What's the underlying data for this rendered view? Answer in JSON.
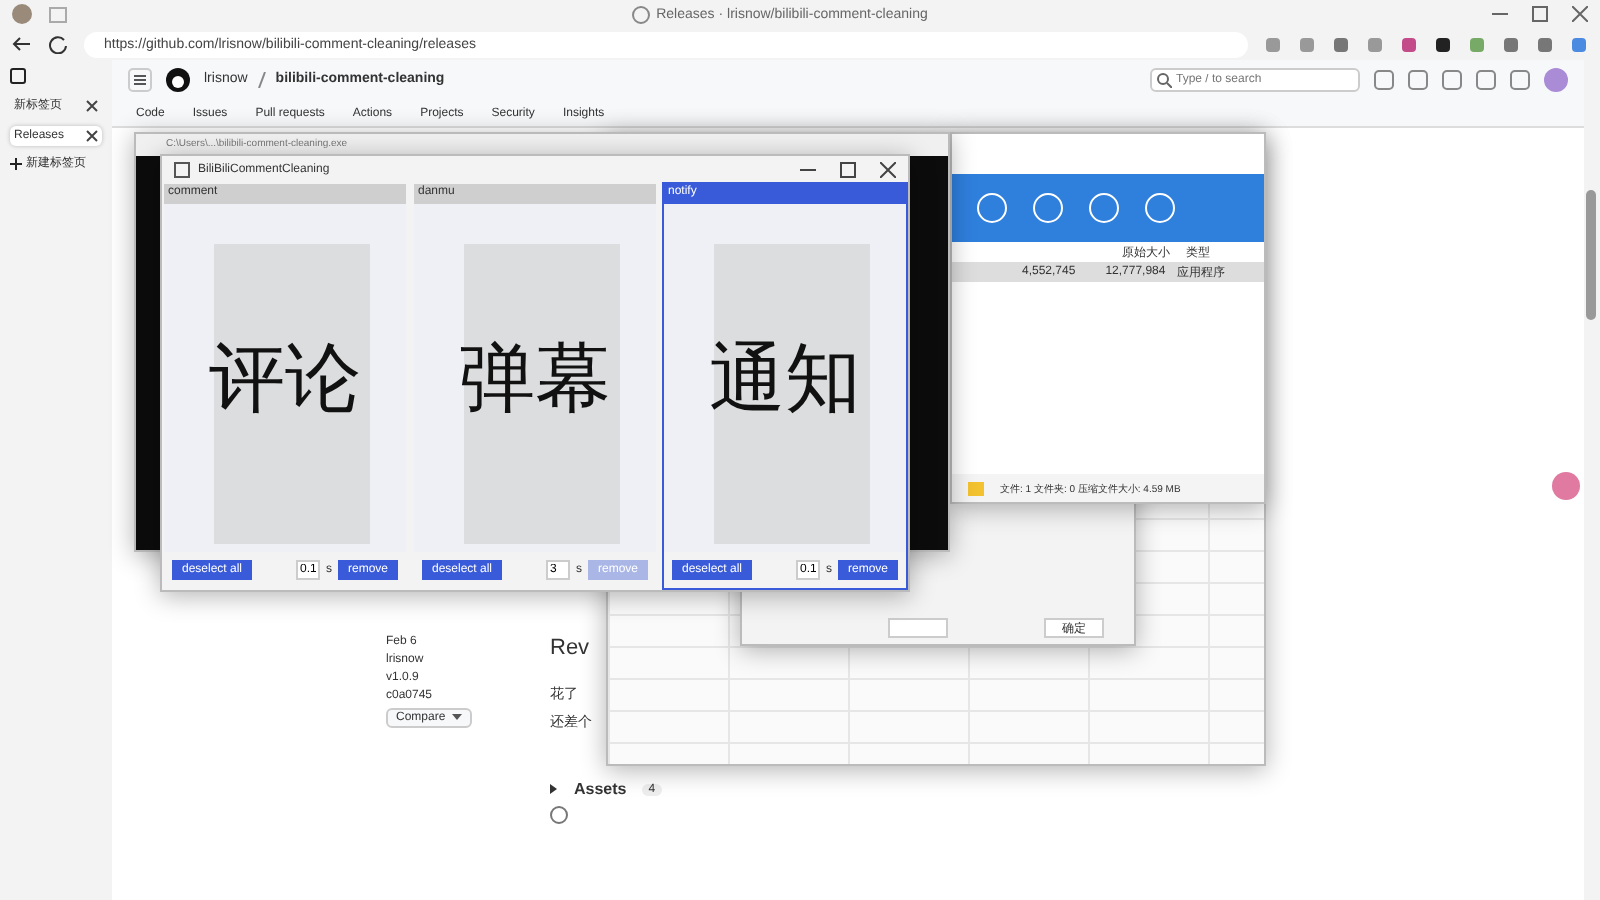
{
  "browser": {
    "tab_title": "Releases · lrisnow/bilibili-comment-cleaning",
    "url": "https://github.com/lrisnow/bilibili-comment-cleaning/releases",
    "vertical_tabs": [
      {
        "label": "新标签页",
        "selected": false
      },
      {
        "label": "Releases",
        "selected": true
      }
    ],
    "new_tab": "新建标签页"
  },
  "github": {
    "owner": "lrisnow",
    "repo": "bilibili-comment-cleaning",
    "search_placeholder": "Type / to search",
    "nav": [
      {
        "label": "Code",
        "selected": false
      },
      {
        "label": "Issues",
        "selected": false
      },
      {
        "label": "Pull requests",
        "selected": false
      },
      {
        "label": "Actions",
        "selected": false
      },
      {
        "label": "Projects",
        "selected": false
      },
      {
        "label": "Security",
        "selected": false
      },
      {
        "label": "Insights",
        "selected": false
      }
    ],
    "release": {
      "date": "Feb 6",
      "author": "lrisnow",
      "tag": "v1.0.9",
      "commit": "c0a0745",
      "compare": "Compare",
      "title": "Rev",
      "body": [
        "花了",
        "还差个"
      ],
      "assets": "Assets",
      "assets_count": "4"
    }
  },
  "console": {
    "title": "C:\\Users\\...\\bilibili-comment-cleaning.exe"
  },
  "app": {
    "title": "BiliBiliCommentCleaning",
    "columns": [
      {
        "header": "comment",
        "selected": false,
        "big_label": "评论",
        "deselect": "deselect all",
        "interval": "0.1",
        "unit": "s",
        "remove": "remove",
        "disabled": false
      },
      {
        "header": "danmu",
        "selected": false,
        "big_label": "弹幕",
        "deselect": "deselect all",
        "interval": "3",
        "unit": "s",
        "remove": "remove",
        "disabled": true
      },
      {
        "header": "notify",
        "selected": true,
        "big_label": "通知",
        "deselect": "deselect all",
        "interval": "0.1",
        "unit": "s",
        "remove": "remove",
        "disabled": false
      }
    ]
  },
  "archive": {
    "headers": [
      "原始大小",
      "类型"
    ],
    "row": [
      "4,552,745",
      "12,777,984",
      "应用程序"
    ],
    "status": "文件: 1  文件夹: 0  压缩文件大小: 4.59 MB"
  },
  "dialog": {
    "ok": "确定"
  }
}
